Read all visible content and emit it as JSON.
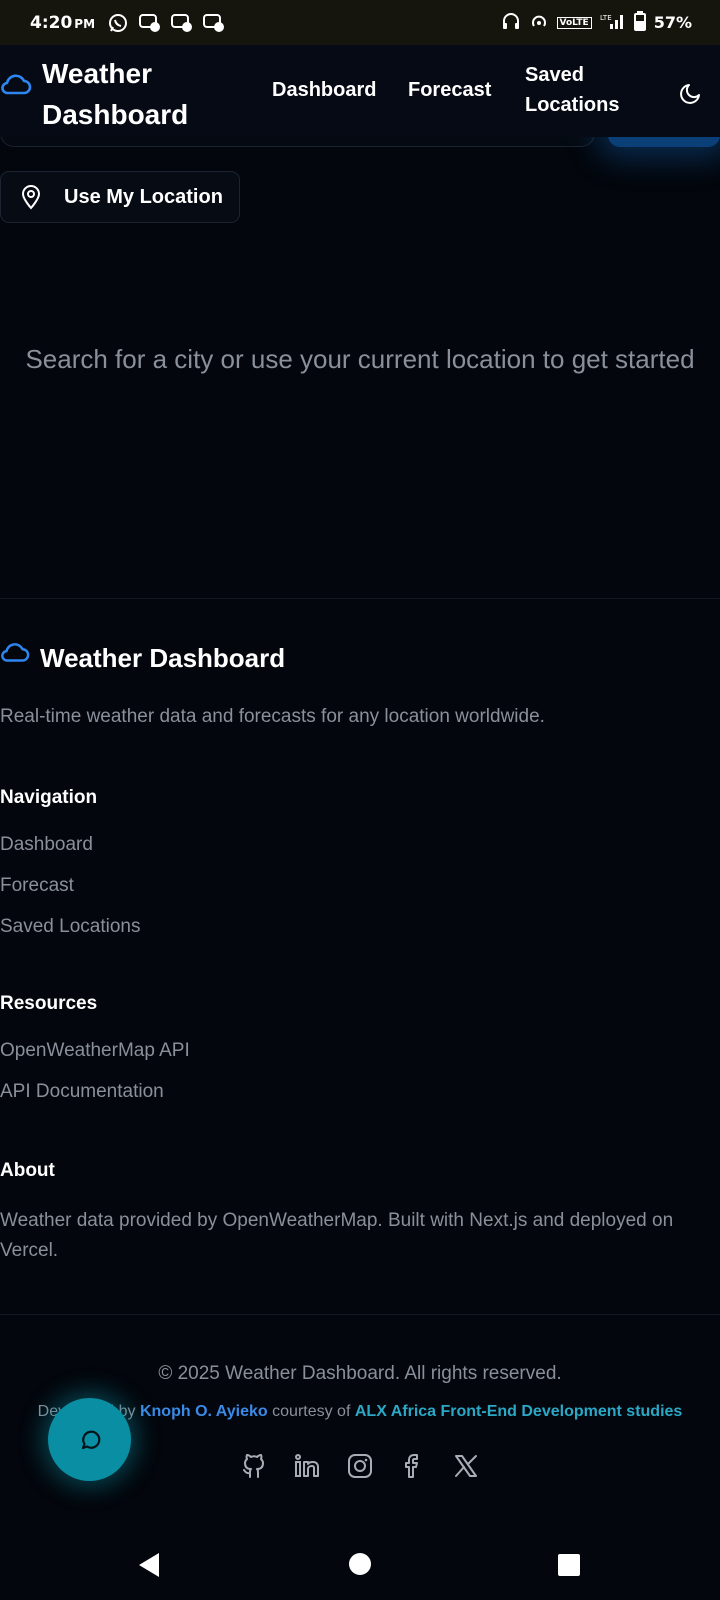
{
  "status_bar": {
    "time": "4:20",
    "ampm": "PM",
    "volte": "VoLTE",
    "network": "LTE",
    "battery": "57%"
  },
  "navbar": {
    "brand_line1": "Weather",
    "brand_line2": "Dashboard",
    "links": [
      "Dashboard",
      "Forecast",
      "Saved",
      "Locations"
    ],
    "theme_icon": "moon-icon"
  },
  "location_button": {
    "label": "Use My Location",
    "icon": "map-pin-icon"
  },
  "empty_state": {
    "message": "Search for a city or use your current location to get started"
  },
  "footer": {
    "brand": "Weather Dashboard",
    "description": "Real-time weather data and forecasts for any location worldwide.",
    "navigation": {
      "heading": "Navigation",
      "links": [
        "Dashboard",
        "Forecast",
        "Saved Locations"
      ]
    },
    "resources": {
      "heading": "Resources",
      "links": [
        "OpenWeatherMap API",
        "API Documentation"
      ]
    },
    "about": {
      "heading": "About",
      "text": "Weather data provided by OpenWeatherMap. Built with Next.js and deployed on Vercel."
    },
    "copyright": "© 2025 Weather Dashboard. All rights reserved.",
    "credits_prefix": "Developed by",
    "credits_author": "Knoph O. Ayieko",
    "credits_middle": "courtesy of",
    "credits_org": "ALX Africa Front-End Development studies",
    "social_icons": [
      "github-icon",
      "linkedin-icon",
      "instagram-icon",
      "facebook-icon",
      "x-icon"
    ]
  },
  "colors": {
    "accent": "#3a8be8",
    "fab": "#0a8ea3",
    "background": "#03060c",
    "muted": "#8a909a"
  }
}
